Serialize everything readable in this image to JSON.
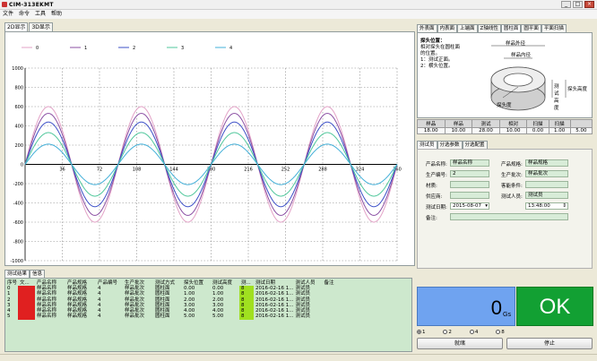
{
  "app": {
    "title": "CIM-313EKMT"
  },
  "window": {
    "minimize": "_",
    "maximize": "□",
    "close": "×"
  },
  "menu": [
    "文件",
    "命令",
    "工具",
    "帮助"
  ],
  "left_tabs": [
    "2D显示",
    "3D显示"
  ],
  "chart_data": {
    "type": "line",
    "series": [
      {
        "name": "0",
        "color": "#e3a3c7",
        "amplitude": 600
      },
      {
        "name": "1",
        "color": "#8b4fa3",
        "amplitude": 530
      },
      {
        "name": "2",
        "color": "#3b4fc7",
        "amplitude": 440
      },
      {
        "name": "3",
        "color": "#4fc79b",
        "amplitude": 330
      },
      {
        "name": "4",
        "color": "#43b0d9",
        "amplitude": 210
      }
    ],
    "period": 90,
    "xlim": [
      0,
      360
    ],
    "ylim": [
      -1000,
      1000
    ],
    "xticks": [
      36,
      72,
      108,
      144,
      180,
      216,
      252,
      288,
      324,
      360
    ],
    "yticks": [
      1000,
      800,
      600,
      400,
      200,
      0,
      -200,
      -400,
      -600,
      -800,
      -1000
    ],
    "grid": true,
    "legend": "top"
  },
  "right_tabs": [
    "外表面",
    "内表面",
    "上端面",
    "Z轴线性",
    "圆柱面",
    "圆平面",
    "平面扫描"
  ],
  "diagram": {
    "text_lines": [
      "探头位置：",
      "相对探头在圆柱面",
      "的位置。",
      "1：测试正面。",
      "2：横头位置。"
    ],
    "labels": [
      "样品外径",
      "样品内径",
      "测试高度",
      "探头高度",
      "探头度"
    ]
  },
  "param_table": {
    "headers": [
      "样品",
      "样品",
      "测试",
      "相对",
      "扫描",
      "扫描"
    ],
    "values": [
      "18.00",
      "10.00",
      "28.00",
      "10.00",
      "0.00",
      "1.00",
      "5.00"
    ]
  },
  "sub_tabs": [
    "测试员",
    "分选参数",
    "分选配置"
  ],
  "form": {
    "product_name_label": "产品名称:",
    "product_name": "样品名称",
    "product_spec_label": "产品规格:",
    "product_spec": "样品规格",
    "product_code_label": "生产编号:",
    "product_code": "2",
    "batch_label": "生产批次:",
    "batch": "样品批次",
    "material_label": "材质:",
    "condition_label": "客能条件:",
    "supplier_label": "供应商:",
    "tester_label": "测试人员:",
    "tester": "测试员",
    "date_label": "测试日期:",
    "date": "2015-08-07",
    "time": "13:48:00",
    "remark_label": "备注:"
  },
  "bottom_tabs": [
    "测试结果",
    "信息"
  ],
  "grid": {
    "headers": [
      "序号",
      "文...",
      "产品名称",
      "产品规格",
      "产品编号",
      "生产批次",
      "测试方式",
      "探头位置",
      "测试高度",
      "测...",
      "测试日期",
      "测试人员",
      "备注"
    ],
    "rows": [
      [
        "0",
        "",
        "样品名称",
        "样品规格",
        "4",
        "样品批次",
        "圆柱面",
        "0.00",
        "0.00",
        "8",
        "2016-02-16 1...",
        "测试员",
        ""
      ],
      [
        "1",
        "",
        "样品名称",
        "样品规格",
        "4",
        "样品批次",
        "圆柱面",
        "1.00",
        "1.00",
        "8",
        "2016-02-16 1...",
        "测试员",
        ""
      ],
      [
        "2",
        "",
        "样品名称",
        "样品规格",
        "4",
        "样品批次",
        "圆柱面",
        "2.00",
        "2.00",
        "8",
        "2016-02-16 1...",
        "测试员",
        ""
      ],
      [
        "3",
        "",
        "样品名称",
        "样品规格",
        "4",
        "样品批次",
        "圆柱面",
        "3.00",
        "3.00",
        "8",
        "2016-02-16 1...",
        "测试员",
        ""
      ],
      [
        "4",
        "",
        "样品名称",
        "样品规格",
        "4",
        "样品批次",
        "圆柱面",
        "4.00",
        "4.00",
        "8",
        "2016-02-16 1...",
        "测试员",
        ""
      ],
      [
        "5",
        "",
        "样品名称",
        "样品规格",
        "4",
        "样品批次",
        "圆柱面",
        "5.00",
        "5.00",
        "8",
        "2016-02-16 1...",
        "测试员",
        ""
      ]
    ]
  },
  "gauss": {
    "value": "0",
    "unit": "Gs"
  },
  "result": {
    "text": "OK"
  },
  "radios": [
    "1",
    "2",
    "4",
    "8"
  ],
  "radio_selected": "1",
  "buttons": {
    "ready": "就绪",
    "stop": "停止"
  }
}
